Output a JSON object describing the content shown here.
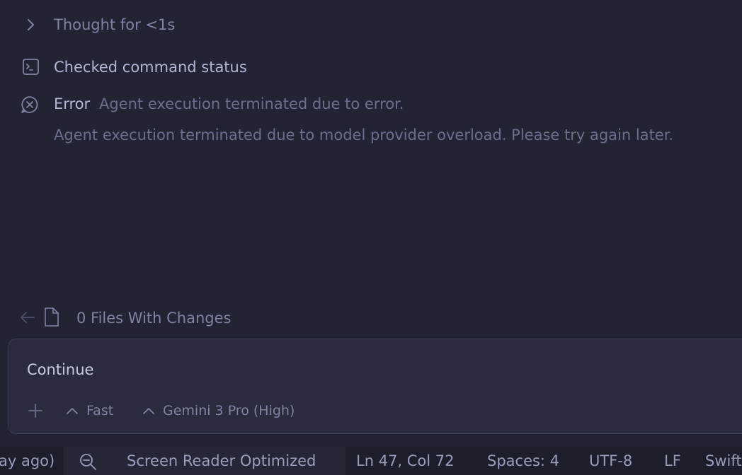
{
  "thought": {
    "label": "Thought for <1s",
    "icon": "chevron-right-icon"
  },
  "checked": {
    "label": "Checked command status",
    "icon": "terminal-icon"
  },
  "error": {
    "label": "Error",
    "summary": "Agent execution terminated due to error.",
    "detail": "Agent execution terminated due to model provider overload. Please try again later.",
    "icon": "error-circle-icon"
  },
  "files": {
    "label": "0 Files With Changes",
    "back_icon": "arrow-left-icon",
    "file_icon": "file-icon"
  },
  "input": {
    "value": "Continue",
    "add_icon": "plus-icon",
    "mode_label": "Fast",
    "model_label": "Gemini 3 Pro (High)"
  },
  "statusbar": {
    "left_fragment": "ay ago)",
    "search_icon": "zoom-icon",
    "screen_reader": "Screen Reader Optimized",
    "position": "Ln 47, Col 72",
    "spaces": "Spaces: 4",
    "encoding": "UTF-8",
    "eol": "LF",
    "language": "Swift"
  },
  "colors": {
    "background": "#222434",
    "input_background": "#2a2c3e",
    "statusbar_background": "#1c1e2b"
  }
}
